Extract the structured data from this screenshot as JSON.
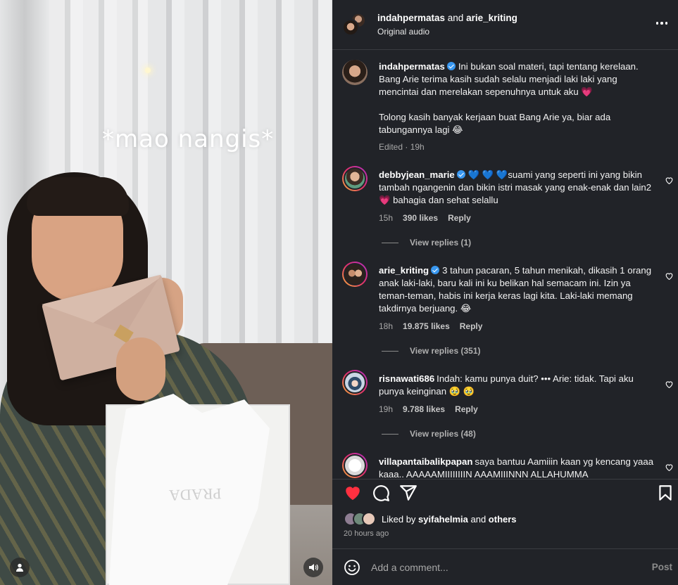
{
  "media": {
    "overlay_caption": "*mao nangis*",
    "box_brand": "PRADA"
  },
  "header": {
    "user_a": "indahpermatas",
    "joiner": " and ",
    "user_b": "arie_kriting",
    "audio": "Original audio"
  },
  "comments": [
    {
      "user": "indahpermatas",
      "verified": true,
      "text": "Ini bukan soal materi, tapi tentang kerelaan. Bang Arie terima kasih sudah selalu menjadi laki laki yang mencintai dan merelakan sepenuhnya untuk aku 💗\n\nTolong kasih banyak kerjaan buat Bang Arie ya, biar ada tabungannya lagi 😂",
      "meta": "Edited · 19h"
    },
    {
      "user": "debbyjean_marie",
      "verified": true,
      "text": "💙 💙 💙suami yang seperti ini yang bikin tambah ngangenin dan bikin istri masak yang enak-enak dan lain2💗 bahagia dan sehat selallu",
      "time": "15h",
      "likes": "390 likes",
      "reply": "Reply",
      "view_replies": "View replies (1)"
    },
    {
      "user": "arie_kriting",
      "verified": true,
      "text": "3 tahun pacaran, 5 tahun menikah, dikasih 1 orang anak laki-laki, baru kali ini ku belikan hal semacam ini. Izin ya teman-teman, habis ini kerja keras lagi kita. Laki-laki memang takdirnya berjuang. 😂",
      "time": "18h",
      "likes": "19.875 likes",
      "reply": "Reply",
      "view_replies": "View replies (351)"
    },
    {
      "user": "risnawati686",
      "verified": false,
      "text": "Indah: kamu punya duit? ••• Arie: tidak. Tapi aku punya keinginan 🥹 🥹",
      "time": "19h",
      "likes": "9.788 likes",
      "reply": "Reply",
      "view_replies": "View replies (48)"
    },
    {
      "user": "villapantaibalikpapan",
      "verified": false,
      "text": "saya bantuu Aamiiin kaan yg kencang yaaa kaaa.. AAAAAMIIIIIIIIN AAAMIIINNN ALLAHUMMA"
    }
  ],
  "likes": {
    "prefix": "Liked by ",
    "user": "syifahelmia",
    "suffix": " and ",
    "others": "others"
  },
  "post_age": "20 hours ago",
  "comment_box": {
    "placeholder": "Add a comment...",
    "post_label": "Post"
  },
  "colors": {
    "panel_bg": "#212328",
    "like_red": "#ff3040",
    "verified_blue": "#3897f0"
  },
  "icons": [
    "heart-icon",
    "comment-icon",
    "share-icon",
    "bookmark-icon",
    "emoji-icon",
    "more-icon",
    "user-tag-icon",
    "audio-icon"
  ]
}
